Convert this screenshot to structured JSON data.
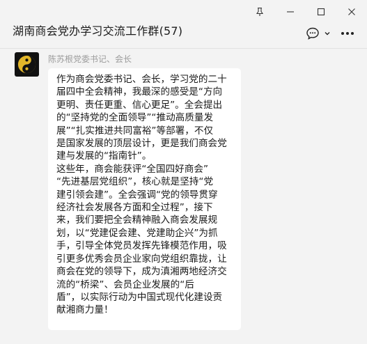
{
  "window": {
    "controls": [
      "pin-icon",
      "minimize-icon",
      "maximize-icon",
      "close-icon"
    ]
  },
  "chat": {
    "title": "湖南商会党办学习交流工作群(57)",
    "actions": [
      "chat-bubble-icon",
      "chevron-down-icon",
      "more-icon"
    ]
  },
  "message": {
    "sender": "陈苏根党委书记、会长",
    "avatar_icon": "yin-yang-icon",
    "paragraph1": [
      "作为商会党委书记、会长，学习党的二十",
      "届四中全会精神，我最深的感受是“方向",
      "更明、责任更重、信心更足”。全会提出",
      "的“坚持党的全面领导”“推动高质量发",
      "展”“扎实推进共同富裕”等部署，不仅",
      "是国家发展的顶层设计，更是我们商会党",
      "建与发展的“指南针”。"
    ],
    "paragraph2": [
      "这些年，商会能获评“全国四好商会”",
      "“先进基层党组织”，核心就是坚持“党",
      "建引领会建”。全会强调“党的领导贯穿",
      "经济社会发展各方面和全过程”，接下",
      "来，我们要把全会精神融入商会发展规",
      "划，以“党建促会建、党建助企兴”为抓",
      "手，引导全体党员发挥先锋模范作用，吸",
      "引更多优秀会员企业家向党组织靠拢，让",
      "商会在党的领导下，成为滇湘两地经济交",
      "流的“桥梁”、会员企业发展的“后",
      "盾”，以实际行动为中国式现代化建设贡",
      "献湘商力量！"
    ]
  },
  "colors": {
    "background": "#f3f3f3",
    "bubble": "#ffffff",
    "sender_name": "#9c9c9c",
    "text": "#1a1a1a"
  }
}
